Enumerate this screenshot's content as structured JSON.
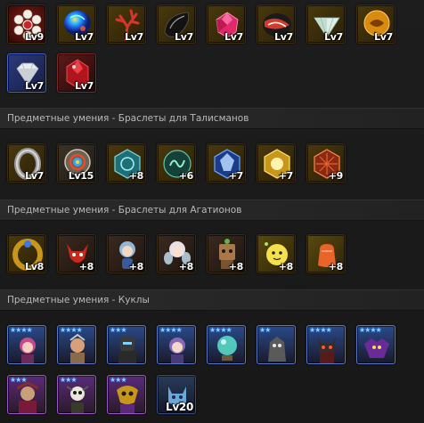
{
  "rows": {
    "talismans_row1": {
      "items": [
        {
          "level": "Lv9",
          "icon": "snowflake-gem-icon"
        },
        {
          "level": "Lv7",
          "icon": "blue-opal-gem-icon"
        },
        {
          "level": "Lv7",
          "icon": "red-coral-icon"
        },
        {
          "level": "Lv7",
          "icon": "black-obsidian-icon"
        },
        {
          "level": "Lv7",
          "icon": "pink-ruby-gem-icon"
        },
        {
          "level": "Lv7",
          "icon": "red-black-stone-icon"
        },
        {
          "level": "Lv7",
          "icon": "white-diamond-icon"
        },
        {
          "level": "Lv7",
          "icon": "amber-stone-icon"
        }
      ]
    },
    "talismans_row2": {
      "items": [
        {
          "level": "Lv7",
          "icon": "clear-diamond-icon"
        },
        {
          "level": "Lv7",
          "icon": "red-crystal-icon"
        }
      ]
    },
    "bracelets_talismans": {
      "title": "Предметные умения - Браслеты для Талисманов",
      "items": [
        {
          "level": "Lv7",
          "icon": "silver-bracelet-icon"
        },
        {
          "level": "Lv15",
          "icon": "rainbow-bracelet-icon"
        },
        {
          "level": "+8",
          "icon": "teal-rune-bracelet-icon"
        },
        {
          "level": "+6",
          "icon": "green-rune-bracelet-icon"
        },
        {
          "level": "+7",
          "icon": "blue-crystal-bracelet-icon"
        },
        {
          "level": "+7",
          "icon": "gold-rune-bracelet-icon"
        },
        {
          "level": "+9",
          "icon": "red-rune-bracelet-icon"
        }
      ]
    },
    "bracelets_agathions": {
      "title": "Предметные умения - Браслеты для Агатионов",
      "items": [
        {
          "level": "Lv8",
          "icon": "gold-agathion-bracelet-icon"
        },
        {
          "level": "+8",
          "icon": "red-imp-agathion-icon"
        },
        {
          "level": "+8",
          "icon": "blue-girl-agathion-icon"
        },
        {
          "level": "+8",
          "icon": "fairy-agathion-icon"
        },
        {
          "level": "+8",
          "icon": "wood-golem-agathion-icon"
        },
        {
          "level": "+8",
          "icon": "star-blob-agathion-icon"
        },
        {
          "level": "+8",
          "icon": "orange-bag-agathion-icon"
        }
      ]
    },
    "dolls": {
      "title": "Предметные умения - Куклы",
      "items": [
        {
          "stars": "★★★★",
          "icon": "pink-hair-doll-icon"
        },
        {
          "stars": "★★★★",
          "icon": "warrior-doll-icon"
        },
        {
          "stars": "★★★",
          "icon": "dark-knight-doll-icon"
        },
        {
          "stars": "★★★★",
          "icon": "elf-doll-icon"
        },
        {
          "stars": "★★★★",
          "icon": "crystal-ball-doll-icon"
        },
        {
          "stars": "★★",
          "icon": "gray-monster-doll-icon"
        },
        {
          "stars": "★★★★",
          "icon": "demon-doll-icon"
        },
        {
          "stars": "★★★★",
          "icon": "purple-dragon-doll-icon"
        }
      ]
    },
    "dolls_row2": {
      "items": [
        {
          "stars": "★★★",
          "icon": "spider-queen-doll-icon"
        },
        {
          "stars": "★★★",
          "icon": "skeleton-doll-icon"
        },
        {
          "stars": "★★★",
          "icon": "golden-mask-doll-icon"
        },
        {
          "level": "Lv20",
          "icon": "blue-cat-doll-icon"
        }
      ]
    }
  }
}
